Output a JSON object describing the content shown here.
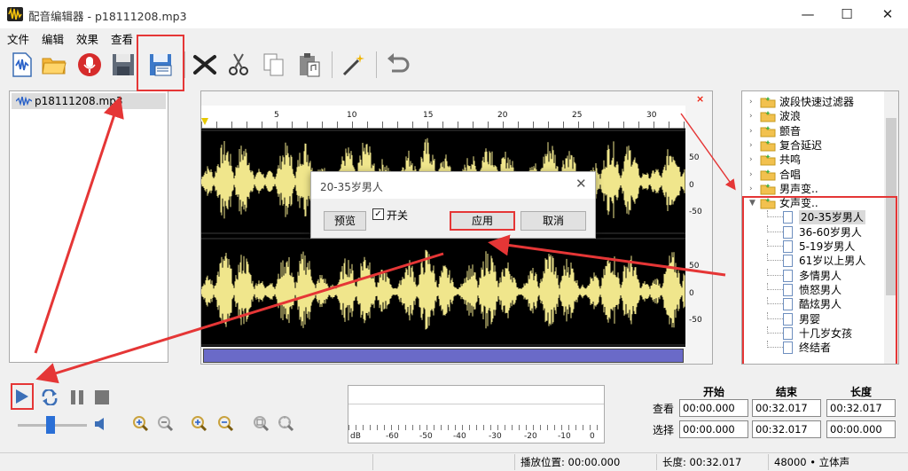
{
  "window": {
    "title": "配音编辑器 - p18111208.mp3",
    "minimize": "—",
    "maximize": "☐",
    "close": "✕"
  },
  "menu": [
    "文件",
    "编辑",
    "效果",
    "查看"
  ],
  "toolbar_icons": [
    "new-icon",
    "open-icon",
    "record-icon",
    "save-icon",
    "save-as-icon",
    "cut-x-icon",
    "scissors-icon",
    "copy-icon",
    "paste-icon",
    "magic-wand-icon",
    "undo-icon"
  ],
  "file_list": {
    "items": [
      "p18111208.mp3"
    ]
  },
  "waveform": {
    "ruler_ticks": [
      "5",
      "10",
      "15",
      "20",
      "25",
      "30"
    ],
    "channel_labels": [
      "50",
      "0",
      "-50"
    ],
    "close_label": "×"
  },
  "tree": {
    "items": [
      {
        "label": "波段快速过滤器",
        "level": 0,
        "expanded": false
      },
      {
        "label": "波浪",
        "level": 0,
        "expanded": false
      },
      {
        "label": "颤音",
        "level": 0,
        "expanded": false
      },
      {
        "label": "复合延迟",
        "level": 0,
        "expanded": false
      },
      {
        "label": "共鸣",
        "level": 0,
        "expanded": false
      },
      {
        "label": "合唱",
        "level": 0,
        "expanded": false
      },
      {
        "label": "男声变..",
        "level": 0,
        "expanded": false
      },
      {
        "label": "女声变..",
        "level": 0,
        "expanded": true
      },
      {
        "label": "20-35岁男人",
        "level": 1,
        "selected": true
      },
      {
        "label": "36-60岁男人",
        "level": 1
      },
      {
        "label": "5-19岁男人",
        "level": 1
      },
      {
        "label": "61岁以上男人",
        "level": 1
      },
      {
        "label": "多情男人",
        "level": 1
      },
      {
        "label": "愤怒男人",
        "level": 1
      },
      {
        "label": "酷炫男人",
        "level": 1
      },
      {
        "label": "男婴",
        "level": 1
      },
      {
        "label": "十几岁女孩",
        "level": 1
      },
      {
        "label": "终结者",
        "level": 1
      }
    ]
  },
  "dialog": {
    "title": "20-35岁男人",
    "close": "✕",
    "preview_label": "预览",
    "toggle_label": "开关",
    "toggle_checked": true,
    "apply_label": "应用",
    "cancel_label": "取消"
  },
  "meter": {
    "labels": [
      "dB",
      "-60",
      "-50",
      "-40",
      "-30",
      "-20",
      "-10",
      "0"
    ]
  },
  "time": {
    "col_start": "开始",
    "col_end": "结束",
    "col_length": "长度",
    "row_view": "查看",
    "row_select": "选择",
    "view_start": "00:00.000",
    "view_end": "00:32.017",
    "view_length": "00:32.017",
    "select_start": "00:00.000",
    "select_end": "00:32.017",
    "select_length": "00:00.000"
  },
  "status": {
    "play_position": "播放位置: 00:00.000",
    "length": "长度: 00:32.017",
    "format": "48000 • 立体声"
  },
  "colors": {
    "wave": "#f0e68c",
    "wave_bg": "#000000",
    "annotation": "#e53636"
  }
}
